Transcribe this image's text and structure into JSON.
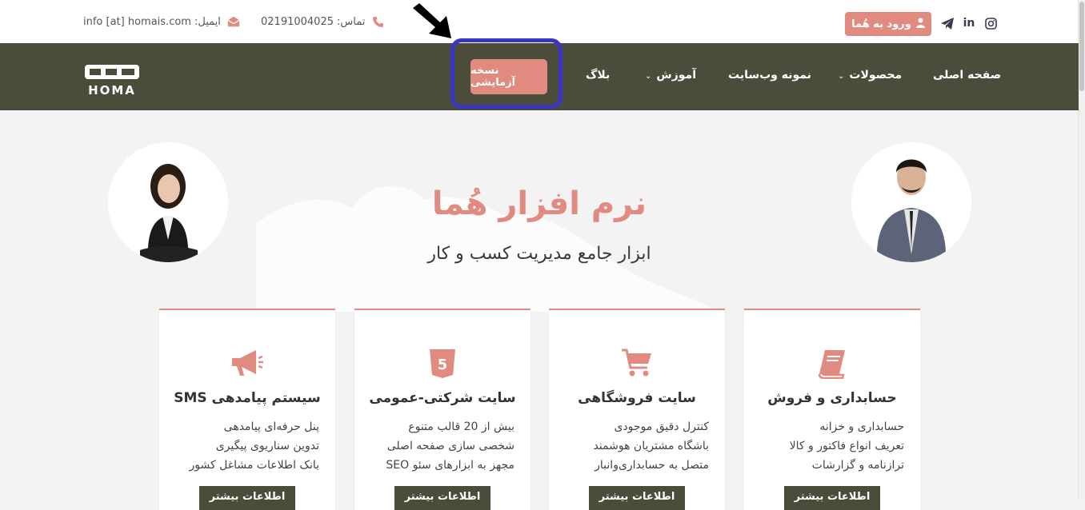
{
  "topbar": {
    "email": {
      "label": "ایمیل:",
      "value": "info [at] homais.com"
    },
    "phone": {
      "label": "تماس:",
      "value": "02191004025"
    },
    "login_label": "ورود به هُما"
  },
  "nav": {
    "home": "صفحه اصلی",
    "products": "محصولات",
    "sample_site": "نمونه وب‌سایت",
    "education": "آموزش",
    "blog": "بلاگ",
    "trial": "نسخه آزمایشی",
    "logo_text": "HOMA"
  },
  "hero": {
    "title": "نرم افزار هُما",
    "subtitle": "ابزار جامع مدیریت کسب و کار"
  },
  "cards": [
    {
      "title": "حسابداری و فروش",
      "icon": "book-icon",
      "lines": [
        "حسابداری و خزانه",
        "تعریف انواع فاکتور و کالا",
        "ترازنامه و گزارشات"
      ],
      "button": "اطلاعات بیشتر"
    },
    {
      "title": "سایت فروشگاهی",
      "icon": "cart-icon",
      "lines": [
        "کنترل دقیق موجودی",
        "باشگاه مشتریان هوشمند",
        "متصل به حسابداری‌وانبار"
      ],
      "button": "اطلاعات بیشتر"
    },
    {
      "title": "سایت شرکتی-عمومی",
      "icon": "html5-icon",
      "lines": [
        "بیش از 20 قالب متنوع",
        "شخصی سازی صفحه اصلی",
        "مجهز به ابزارهای سئو SEO"
      ],
      "button": "اطلاعات بیشتر"
    },
    {
      "title": "سیستم پیامدهی SMS",
      "icon": "megaphone-icon",
      "lines": [
        "پنل حرفه‌ای پیامدهی",
        "تدوین سناریوی پیگیری",
        "بانک اطلاعات مشاغل کشور"
      ],
      "button": "اطلاعات بیشتر"
    }
  ],
  "colors": {
    "accent": "#e08a80",
    "navbar": "#4b4d3a",
    "highlight": "#3a35c8"
  }
}
